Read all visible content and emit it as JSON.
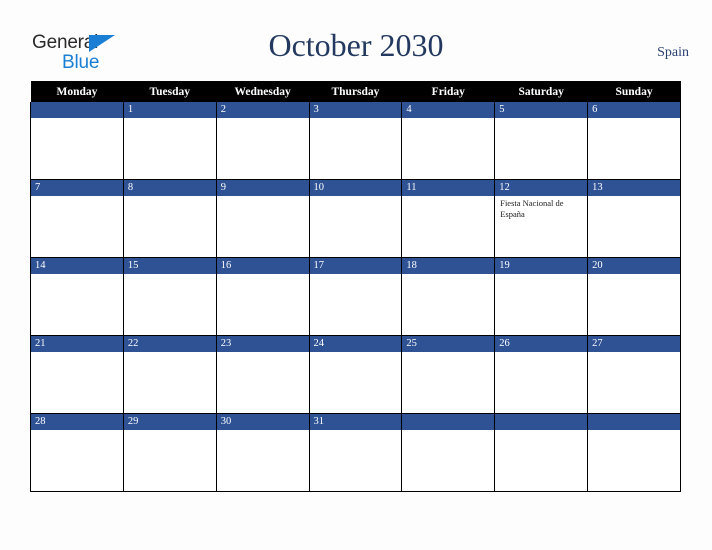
{
  "brand": {
    "name_part1": "General",
    "name_part2": "Blue",
    "triangle_icon": "triangle-right-icon",
    "color_dark": "#2b2b2b",
    "color_blue": "#1a7fd4"
  },
  "header": {
    "title": "October 2030",
    "country": "Spain",
    "title_color": "#23395f",
    "country_color": "#2c4272"
  },
  "calendar": {
    "month": "October",
    "year": "2030",
    "weekday_headers": [
      "Monday",
      "Tuesday",
      "Wednesday",
      "Thursday",
      "Friday",
      "Saturday",
      "Sunday"
    ],
    "header_bg": "#000000",
    "header_text_color": "#ffffff",
    "daybar_bg": "#2f5295",
    "daybar_text_color": "#ffffff",
    "cell_bg": "#ffffff",
    "weeks": [
      [
        {
          "day": "",
          "events": []
        },
        {
          "day": "1",
          "events": []
        },
        {
          "day": "2",
          "events": []
        },
        {
          "day": "3",
          "events": []
        },
        {
          "day": "4",
          "events": []
        },
        {
          "day": "5",
          "events": []
        },
        {
          "day": "6",
          "events": []
        }
      ],
      [
        {
          "day": "7",
          "events": []
        },
        {
          "day": "8",
          "events": []
        },
        {
          "day": "9",
          "events": []
        },
        {
          "day": "10",
          "events": []
        },
        {
          "day": "11",
          "events": []
        },
        {
          "day": "12",
          "events": [
            "Fiesta Nacional de España"
          ]
        },
        {
          "day": "13",
          "events": []
        }
      ],
      [
        {
          "day": "14",
          "events": []
        },
        {
          "day": "15",
          "events": []
        },
        {
          "day": "16",
          "events": []
        },
        {
          "day": "17",
          "events": []
        },
        {
          "day": "18",
          "events": []
        },
        {
          "day": "19",
          "events": []
        },
        {
          "day": "20",
          "events": []
        }
      ],
      [
        {
          "day": "21",
          "events": []
        },
        {
          "day": "22",
          "events": []
        },
        {
          "day": "23",
          "events": []
        },
        {
          "day": "24",
          "events": []
        },
        {
          "day": "25",
          "events": []
        },
        {
          "day": "26",
          "events": []
        },
        {
          "day": "27",
          "events": []
        }
      ],
      [
        {
          "day": "28",
          "events": []
        },
        {
          "day": "29",
          "events": []
        },
        {
          "day": "30",
          "events": []
        },
        {
          "day": "31",
          "events": []
        },
        {
          "day": "",
          "events": []
        },
        {
          "day": "",
          "events": []
        },
        {
          "day": "",
          "events": []
        }
      ]
    ]
  }
}
